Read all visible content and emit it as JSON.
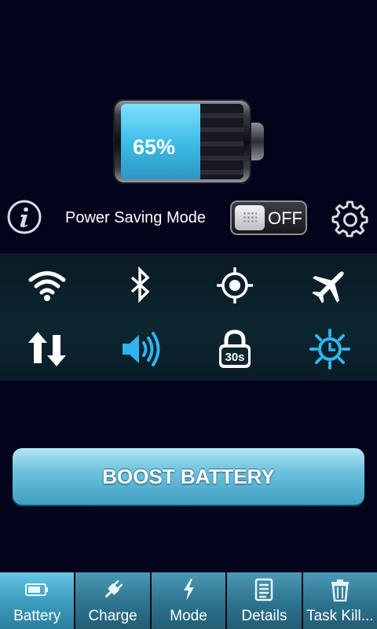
{
  "battery": {
    "percent_label": "65%",
    "level": 0.65,
    "fill_color": "#3fbde8"
  },
  "power_saving": {
    "label": "Power Saving Mode",
    "toggle_state": "OFF"
  },
  "quick_toggles": [
    {
      "name": "wifi",
      "icon": "wifi-icon",
      "color": "#ffffff"
    },
    {
      "name": "bluetooth",
      "icon": "bluetooth-icon",
      "color": "#ffffff"
    },
    {
      "name": "gps",
      "icon": "gps-icon",
      "color": "#ffffff"
    },
    {
      "name": "airplane",
      "icon": "airplane-icon",
      "color": "#ffffff"
    },
    {
      "name": "mobile-data",
      "icon": "mobile-data-icon",
      "color": "#ffffff"
    },
    {
      "name": "sound",
      "icon": "speaker-icon",
      "color": "#2fb4ee"
    },
    {
      "name": "screen-timeout",
      "icon": "lock-timeout-icon",
      "label": "30s",
      "color": "#ffffff"
    },
    {
      "name": "brightness",
      "icon": "brightness-auto-icon",
      "color": "#2fb4ee"
    }
  ],
  "boost_button": {
    "label": "BOOST BATTERY"
  },
  "tabs": [
    {
      "label": "Battery",
      "icon": "battery-icon"
    },
    {
      "label": "Charge",
      "icon": "plug-icon"
    },
    {
      "label": "Mode",
      "icon": "lightning-icon"
    },
    {
      "label": "Details",
      "icon": "details-icon"
    },
    {
      "label": "Task Kill...",
      "icon": "trash-icon"
    }
  ],
  "colors": {
    "background": "#03031c",
    "accent": "#2fb4ee"
  }
}
